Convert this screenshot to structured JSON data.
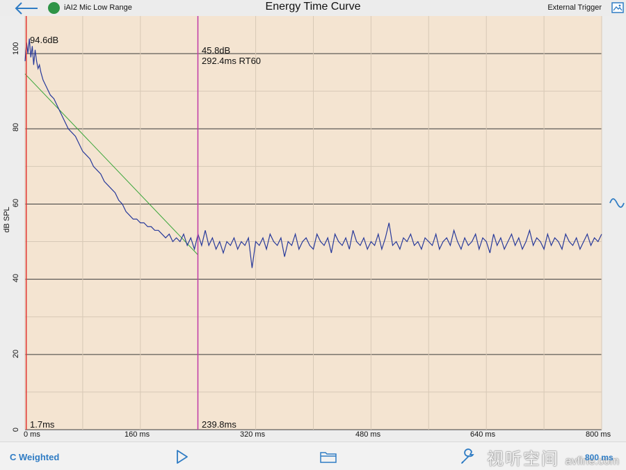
{
  "header": {
    "back_icon": "back-arrow-icon",
    "status_color": "#2e9447",
    "mic_label": "iAI2 Mic Low Range",
    "title": "Energy Time Curve",
    "trigger_label": "External Trigger",
    "image_icon": "image-icon"
  },
  "side": {
    "wave_icon": "sine-wave-icon"
  },
  "footer": {
    "weighting_label": "C Weighted",
    "play_icon": "play-icon",
    "folder_icon": "folder-icon",
    "wrench_icon": "wrench-icon",
    "watermark": "视听空间",
    "watermark_url": "avfine.com",
    "range_label": "800 ms"
  },
  "colors": {
    "plot_background": "#f4e4d1",
    "grid": "#3a3a3a",
    "trace": "#27399a",
    "fit_line": "#3aa63a",
    "start_marker": "#e23b3b",
    "rt_marker": "#c03aa8",
    "accent": "#2f7cc4"
  },
  "chart_data": {
    "type": "line",
    "title": "Energy Time Curve",
    "xlabel": "",
    "ylabel": "dB SPL",
    "x_unit": "ms",
    "xlim": [
      0,
      800
    ],
    "ylim": [
      0,
      110
    ],
    "x_ticks": [
      "0 ms",
      "160 ms",
      "320 ms",
      "480 ms",
      "640 ms",
      "800 ms"
    ],
    "y_ticks": [
      "0",
      "20",
      "40",
      "60",
      "80",
      "100"
    ],
    "grid": true,
    "series": [
      {
        "points": [
          [
            0,
            98
          ],
          [
            2,
            103
          ],
          [
            4,
            100
          ],
          [
            6,
            104
          ],
          [
            8,
            99
          ],
          [
            10,
            102
          ],
          [
            12,
            97
          ],
          [
            14,
            101
          ],
          [
            16,
            98
          ],
          [
            18,
            96
          ],
          [
            20,
            97
          ],
          [
            22,
            95
          ],
          [
            25,
            93
          ],
          [
            30,
            91
          ],
          [
            35,
            89
          ],
          [
            40,
            88
          ],
          [
            45,
            86
          ],
          [
            50,
            84
          ],
          [
            55,
            82
          ],
          [
            60,
            80
          ],
          [
            65,
            79
          ],
          [
            70,
            78
          ],
          [
            75,
            76
          ],
          [
            80,
            74
          ],
          [
            85,
            73
          ],
          [
            90,
            72
          ],
          [
            95,
            70
          ],
          [
            100,
            69
          ],
          [
            105,
            68
          ],
          [
            110,
            66
          ],
          [
            115,
            65
          ],
          [
            120,
            64
          ],
          [
            125,
            63
          ],
          [
            130,
            61
          ],
          [
            135,
            60
          ],
          [
            140,
            58
          ],
          [
            145,
            57
          ],
          [
            150,
            56
          ],
          [
            155,
            56
          ],
          [
            160,
            55
          ],
          [
            165,
            55
          ],
          [
            170,
            54
          ],
          [
            175,
            54
          ],
          [
            180,
            53
          ],
          [
            185,
            53
          ],
          [
            190,
            52
          ],
          [
            195,
            51
          ],
          [
            200,
            52
          ],
          [
            205,
            50
          ],
          [
            210,
            51
          ],
          [
            215,
            50
          ],
          [
            220,
            52
          ],
          [
            225,
            49
          ],
          [
            230,
            51
          ],
          [
            235,
            48
          ],
          [
            240,
            52
          ],
          [
            245,
            49
          ],
          [
            250,
            53
          ],
          [
            255,
            49
          ],
          [
            260,
            51
          ],
          [
            265,
            48
          ],
          [
            270,
            50
          ],
          [
            275,
            47
          ],
          [
            280,
            50
          ],
          [
            285,
            49
          ],
          [
            290,
            51
          ],
          [
            295,
            48
          ],
          [
            300,
            50
          ],
          [
            305,
            49
          ],
          [
            310,
            51
          ],
          [
            315,
            43
          ],
          [
            320,
            50
          ],
          [
            325,
            49
          ],
          [
            330,
            51
          ],
          [
            335,
            48
          ],
          [
            340,
            52
          ],
          [
            345,
            50
          ],
          [
            350,
            49
          ],
          [
            355,
            51
          ],
          [
            360,
            46
          ],
          [
            365,
            50
          ],
          [
            370,
            49
          ],
          [
            375,
            52
          ],
          [
            380,
            48
          ],
          [
            385,
            50
          ],
          [
            390,
            51
          ],
          [
            395,
            49
          ],
          [
            400,
            48
          ],
          [
            405,
            52
          ],
          [
            410,
            50
          ],
          [
            415,
            49
          ],
          [
            420,
            51
          ],
          [
            425,
            47
          ],
          [
            430,
            52
          ],
          [
            435,
            50
          ],
          [
            440,
            49
          ],
          [
            445,
            51
          ],
          [
            450,
            48
          ],
          [
            455,
            53
          ],
          [
            460,
            50
          ],
          [
            465,
            49
          ],
          [
            470,
            51
          ],
          [
            475,
            48
          ],
          [
            480,
            50
          ],
          [
            485,
            49
          ],
          [
            490,
            52
          ],
          [
            495,
            48
          ],
          [
            500,
            51
          ],
          [
            505,
            55
          ],
          [
            510,
            49
          ],
          [
            515,
            50
          ],
          [
            520,
            48
          ],
          [
            525,
            51
          ],
          [
            530,
            50
          ],
          [
            535,
            52
          ],
          [
            540,
            49
          ],
          [
            545,
            50
          ],
          [
            550,
            48
          ],
          [
            555,
            51
          ],
          [
            560,
            50
          ],
          [
            565,
            49
          ],
          [
            570,
            52
          ],
          [
            575,
            48
          ],
          [
            580,
            50
          ],
          [
            585,
            51
          ],
          [
            590,
            49
          ],
          [
            595,
            53
          ],
          [
            600,
            50
          ],
          [
            605,
            48
          ],
          [
            610,
            51
          ],
          [
            615,
            49
          ],
          [
            620,
            50
          ],
          [
            625,
            52
          ],
          [
            630,
            48
          ],
          [
            635,
            51
          ],
          [
            640,
            50
          ],
          [
            645,
            47
          ],
          [
            650,
            52
          ],
          [
            655,
            49
          ],
          [
            660,
            51
          ],
          [
            665,
            48
          ],
          [
            670,
            50
          ],
          [
            675,
            52
          ],
          [
            680,
            49
          ],
          [
            685,
            51
          ],
          [
            690,
            48
          ],
          [
            695,
            50
          ],
          [
            700,
            53
          ],
          [
            705,
            49
          ],
          [
            710,
            51
          ],
          [
            715,
            50
          ],
          [
            720,
            48
          ],
          [
            725,
            52
          ],
          [
            730,
            49
          ],
          [
            735,
            51
          ],
          [
            740,
            50
          ],
          [
            745,
            48
          ],
          [
            750,
            52
          ],
          [
            755,
            50
          ],
          [
            760,
            49
          ],
          [
            765,
            51
          ],
          [
            770,
            48
          ],
          [
            775,
            50
          ],
          [
            780,
            52
          ],
          [
            785,
            49
          ],
          [
            790,
            51
          ],
          [
            795,
            50
          ],
          [
            800,
            52
          ]
        ]
      }
    ],
    "fit_line": [
      [
        0,
        94.6
      ],
      [
        239.8,
        46.5
      ]
    ],
    "markers": {
      "start": {
        "x_ms": 1.7,
        "label": "1.7ms",
        "level_label": "94.6dB"
      },
      "rt": {
        "x_ms": 239.8,
        "label": "239.8ms",
        "level_label": "45.8dB",
        "rt60_label": "292.4ms RT60"
      }
    }
  }
}
